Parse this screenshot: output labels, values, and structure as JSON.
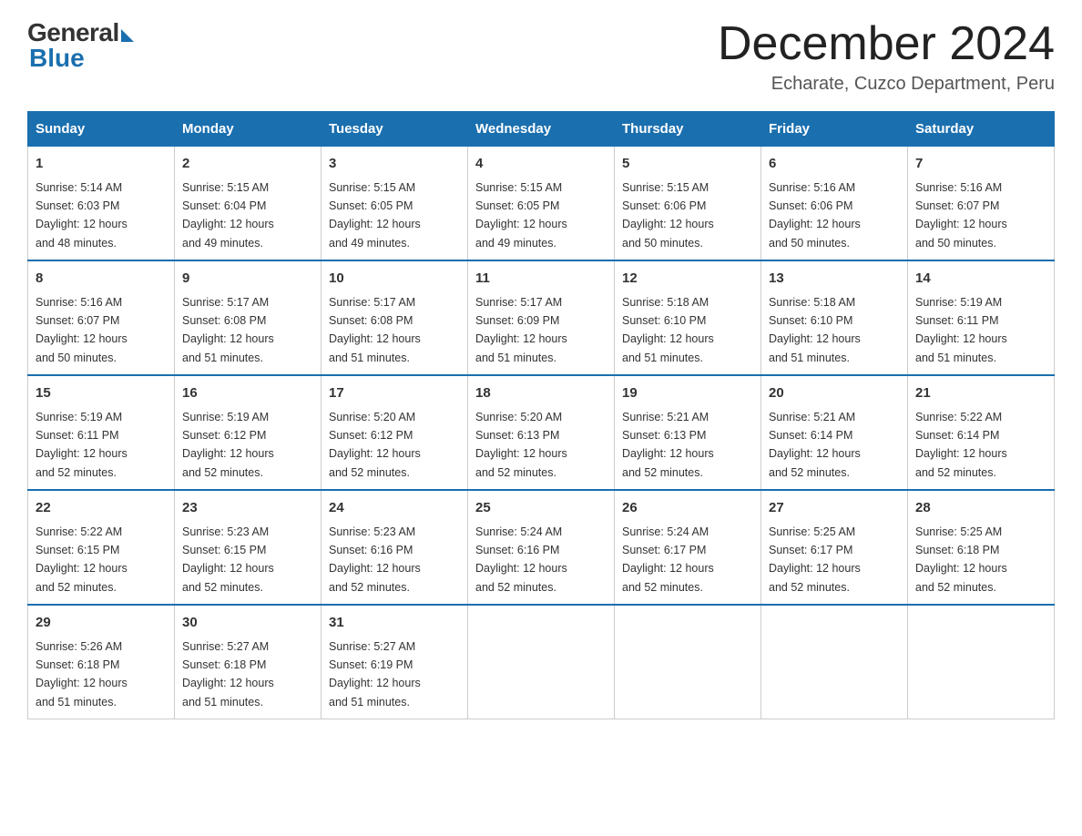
{
  "header": {
    "logo_general": "General",
    "logo_blue": "Blue",
    "title": "December 2024",
    "subtitle": "Echarate, Cuzco Department, Peru"
  },
  "days_of_week": [
    "Sunday",
    "Monday",
    "Tuesday",
    "Wednesday",
    "Thursday",
    "Friday",
    "Saturday"
  ],
  "weeks": [
    [
      {
        "day": "1",
        "sunrise": "5:14 AM",
        "sunset": "6:03 PM",
        "daylight": "12 hours and 48 minutes."
      },
      {
        "day": "2",
        "sunrise": "5:15 AM",
        "sunset": "6:04 PM",
        "daylight": "12 hours and 49 minutes."
      },
      {
        "day": "3",
        "sunrise": "5:15 AM",
        "sunset": "6:05 PM",
        "daylight": "12 hours and 49 minutes."
      },
      {
        "day": "4",
        "sunrise": "5:15 AM",
        "sunset": "6:05 PM",
        "daylight": "12 hours and 49 minutes."
      },
      {
        "day": "5",
        "sunrise": "5:15 AM",
        "sunset": "6:06 PM",
        "daylight": "12 hours and 50 minutes."
      },
      {
        "day": "6",
        "sunrise": "5:16 AM",
        "sunset": "6:06 PM",
        "daylight": "12 hours and 50 minutes."
      },
      {
        "day": "7",
        "sunrise": "5:16 AM",
        "sunset": "6:07 PM",
        "daylight": "12 hours and 50 minutes."
      }
    ],
    [
      {
        "day": "8",
        "sunrise": "5:16 AM",
        "sunset": "6:07 PM",
        "daylight": "12 hours and 50 minutes."
      },
      {
        "day": "9",
        "sunrise": "5:17 AM",
        "sunset": "6:08 PM",
        "daylight": "12 hours and 51 minutes."
      },
      {
        "day": "10",
        "sunrise": "5:17 AM",
        "sunset": "6:08 PM",
        "daylight": "12 hours and 51 minutes."
      },
      {
        "day": "11",
        "sunrise": "5:17 AM",
        "sunset": "6:09 PM",
        "daylight": "12 hours and 51 minutes."
      },
      {
        "day": "12",
        "sunrise": "5:18 AM",
        "sunset": "6:10 PM",
        "daylight": "12 hours and 51 minutes."
      },
      {
        "day": "13",
        "sunrise": "5:18 AM",
        "sunset": "6:10 PM",
        "daylight": "12 hours and 51 minutes."
      },
      {
        "day": "14",
        "sunrise": "5:19 AM",
        "sunset": "6:11 PM",
        "daylight": "12 hours and 51 minutes."
      }
    ],
    [
      {
        "day": "15",
        "sunrise": "5:19 AM",
        "sunset": "6:11 PM",
        "daylight": "12 hours and 52 minutes."
      },
      {
        "day": "16",
        "sunrise": "5:19 AM",
        "sunset": "6:12 PM",
        "daylight": "12 hours and 52 minutes."
      },
      {
        "day": "17",
        "sunrise": "5:20 AM",
        "sunset": "6:12 PM",
        "daylight": "12 hours and 52 minutes."
      },
      {
        "day": "18",
        "sunrise": "5:20 AM",
        "sunset": "6:13 PM",
        "daylight": "12 hours and 52 minutes."
      },
      {
        "day": "19",
        "sunrise": "5:21 AM",
        "sunset": "6:13 PM",
        "daylight": "12 hours and 52 minutes."
      },
      {
        "day": "20",
        "sunrise": "5:21 AM",
        "sunset": "6:14 PM",
        "daylight": "12 hours and 52 minutes."
      },
      {
        "day": "21",
        "sunrise": "5:22 AM",
        "sunset": "6:14 PM",
        "daylight": "12 hours and 52 minutes."
      }
    ],
    [
      {
        "day": "22",
        "sunrise": "5:22 AM",
        "sunset": "6:15 PM",
        "daylight": "12 hours and 52 minutes."
      },
      {
        "day": "23",
        "sunrise": "5:23 AM",
        "sunset": "6:15 PM",
        "daylight": "12 hours and 52 minutes."
      },
      {
        "day": "24",
        "sunrise": "5:23 AM",
        "sunset": "6:16 PM",
        "daylight": "12 hours and 52 minutes."
      },
      {
        "day": "25",
        "sunrise": "5:24 AM",
        "sunset": "6:16 PM",
        "daylight": "12 hours and 52 minutes."
      },
      {
        "day": "26",
        "sunrise": "5:24 AM",
        "sunset": "6:17 PM",
        "daylight": "12 hours and 52 minutes."
      },
      {
        "day": "27",
        "sunrise": "5:25 AM",
        "sunset": "6:17 PM",
        "daylight": "12 hours and 52 minutes."
      },
      {
        "day": "28",
        "sunrise": "5:25 AM",
        "sunset": "6:18 PM",
        "daylight": "12 hours and 52 minutes."
      }
    ],
    [
      {
        "day": "29",
        "sunrise": "5:26 AM",
        "sunset": "6:18 PM",
        "daylight": "12 hours and 51 minutes."
      },
      {
        "day": "30",
        "sunrise": "5:27 AM",
        "sunset": "6:18 PM",
        "daylight": "12 hours and 51 minutes."
      },
      {
        "day": "31",
        "sunrise": "5:27 AM",
        "sunset": "6:19 PM",
        "daylight": "12 hours and 51 minutes."
      },
      null,
      null,
      null,
      null
    ]
  ],
  "labels": {
    "sunrise": "Sunrise:",
    "sunset": "Sunset:",
    "daylight": "Daylight:"
  }
}
